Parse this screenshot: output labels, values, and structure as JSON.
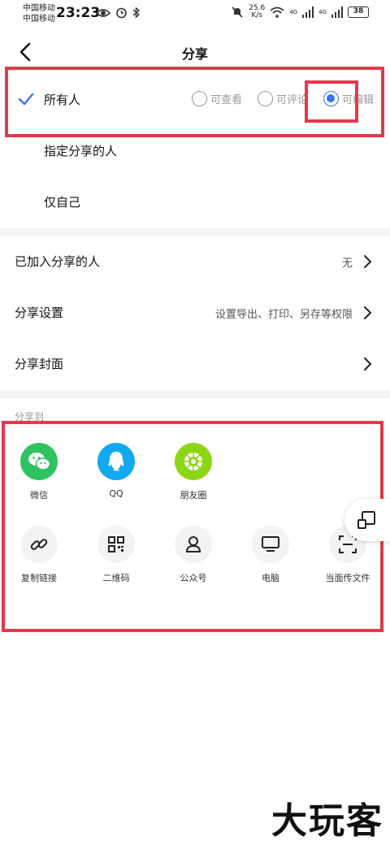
{
  "status_bar": {
    "carrier_1": "中国移动",
    "carrier_2": "中国移动",
    "time": "23:23",
    "net_speed_value": "25.6",
    "net_speed_unit": "K/s",
    "signal_1_label": "4G",
    "signal_2_label": "4G",
    "battery": "38"
  },
  "header": {
    "title": "分享"
  },
  "share_scope": {
    "options": [
      {
        "label": "所有人",
        "selected": true
      },
      {
        "label": "指定分享的人",
        "selected": false
      },
      {
        "label": "仅自己",
        "selected": false
      }
    ],
    "permissions": [
      {
        "label": "可查看",
        "selected": false
      },
      {
        "label": "可评论",
        "selected": false
      },
      {
        "label": "可编辑",
        "selected": true
      }
    ]
  },
  "settings": [
    {
      "label": "已加入分享的人",
      "value": "无"
    },
    {
      "label": "分享设置",
      "value": "设置导出、打印、另存等权限"
    },
    {
      "label": "分享封面",
      "value": ""
    }
  ],
  "share_to": {
    "title": "分享到",
    "apps": [
      {
        "label": "微信",
        "icon": "wechat-icon",
        "color": "#2ec262"
      },
      {
        "label": "QQ",
        "icon": "qq-icon",
        "color": "#12a8ef"
      },
      {
        "label": "朋友圈",
        "icon": "moments-icon",
        "color": "#8dd615"
      }
    ],
    "tools": [
      {
        "label": "复制链接",
        "icon": "link-icon"
      },
      {
        "label": "二维码",
        "icon": "qrcode-icon"
      },
      {
        "label": "公众号",
        "icon": "official-account-icon"
      },
      {
        "label": "电脑",
        "icon": "computer-icon"
      },
      {
        "label": "当面传文件",
        "icon": "scan-icon"
      }
    ]
  },
  "colors": {
    "accent": "#3b73f0",
    "highlight": "#e33a4a",
    "divider": "#f4f5f7"
  },
  "watermark": "大玩客"
}
